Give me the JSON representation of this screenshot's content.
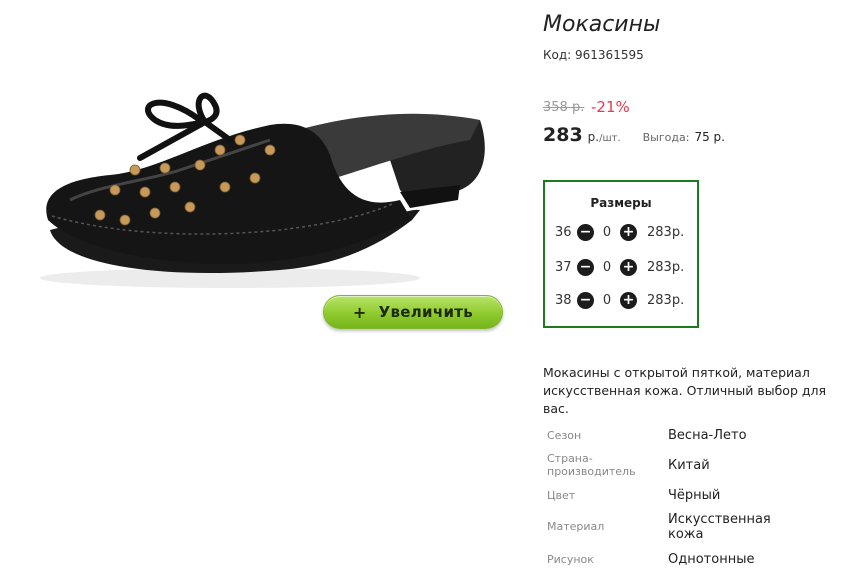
{
  "product": {
    "title": "Мокасины",
    "code": "Код: 961361595",
    "old_price": "358 р.",
    "discount": "-21%",
    "price": "283",
    "unit_rub": "р.",
    "unit_per": "/шт.",
    "benefit_label": "Выгода:",
    "benefit_value": "75 р.",
    "zoom_button": {
      "icon": "+",
      "label": "Увеличить"
    }
  },
  "sizes": {
    "title": "Размеры",
    "rows": [
      {
        "size": "36",
        "qty": "0",
        "price": "283р."
      },
      {
        "size": "37",
        "qty": "0",
        "price": "283р."
      },
      {
        "size": "38",
        "qty": "0",
        "price": "283р."
      }
    ],
    "minus_icon": "minus-icon",
    "plus_icon": "plus-icon"
  },
  "description": "Мокасины с открытой пяткой, материал искусственная кожа. Отличный выбор для вас.",
  "specs": [
    {
      "label": "Сезон",
      "value": "Весна-Лето"
    },
    {
      "label": "Страна-производитель",
      "value": "Китай"
    },
    {
      "label": "Цвет",
      "value": "Чёрный"
    },
    {
      "label": "Материал",
      "value": "Искусственная кожа"
    },
    {
      "label": "Рисунок",
      "value": "Однотонные"
    }
  ],
  "colors": {
    "accent_green": "#1e7a1e",
    "discount_red": "#e63a4e",
    "button_green": "#8fcb2d"
  }
}
